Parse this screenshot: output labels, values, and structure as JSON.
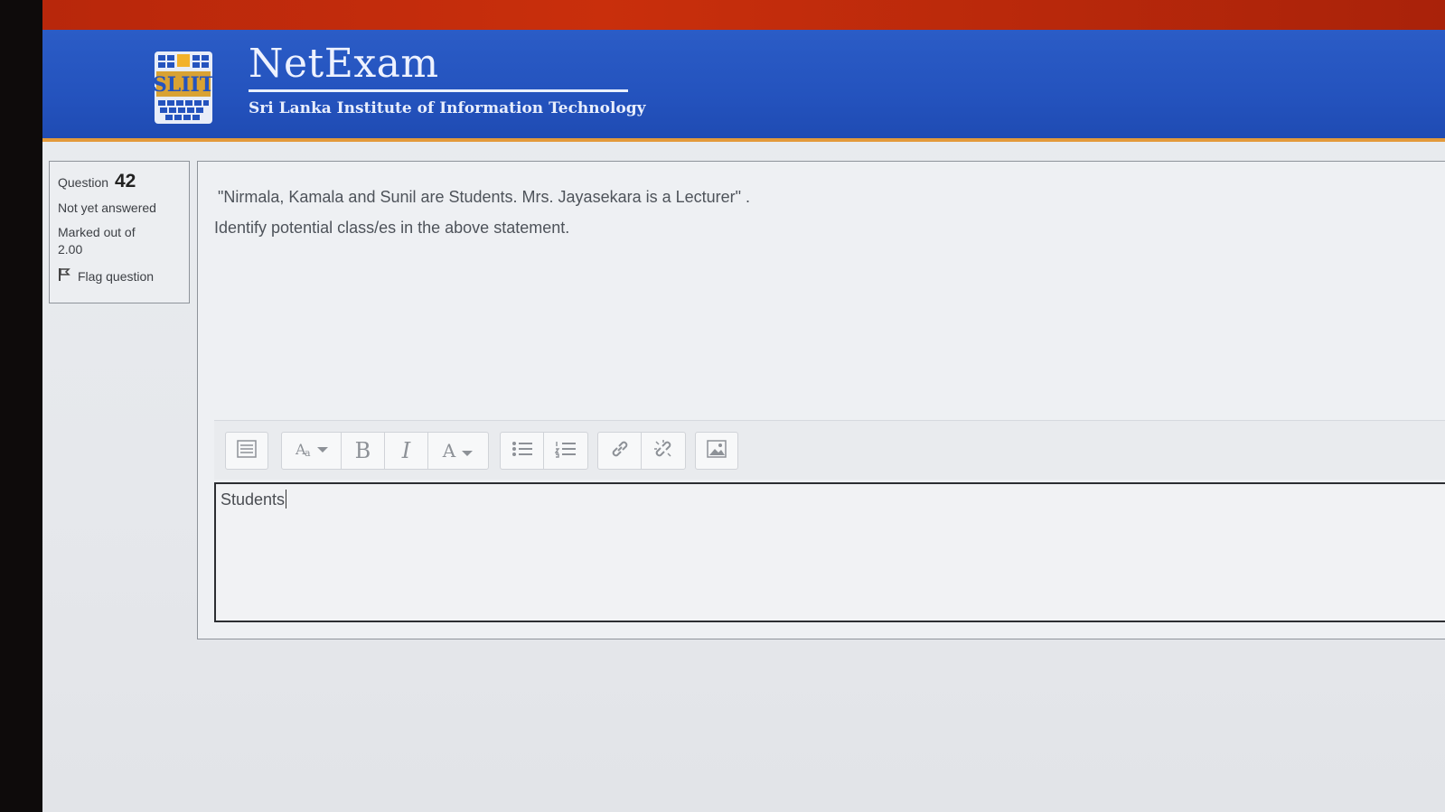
{
  "header": {
    "title": "NetExam",
    "subtitle": "Sri Lanka Institute of Information Technology",
    "logo_text": "SLIIT"
  },
  "question_info": {
    "label": "Question",
    "number": "42",
    "status": "Not yet answered",
    "marked_out_of": "Marked out of 2.00",
    "flag_label": "Flag question"
  },
  "question": {
    "line1": "\"Nirmala, Kamala and Sunil are Students. Mrs. Jayasekara is a Lecturer\" .",
    "line2": "Identify potential class/es in the above statement."
  },
  "toolbar": {
    "buttons": [
      "show-more-icon",
      "paragraph-style-icon",
      "bold-icon",
      "italic-icon",
      "font-color-icon",
      "unordered-list-icon",
      "ordered-list-icon",
      "link-icon",
      "unlink-icon",
      "image-icon"
    ],
    "bold_glyph": "B",
    "italic_glyph": "I",
    "font_glyph": "A"
  },
  "answer": {
    "value": "Students"
  },
  "colors": {
    "banner": "#2453be",
    "top_strip": "#c92f0c",
    "accent_line": "#e39a3b"
  }
}
